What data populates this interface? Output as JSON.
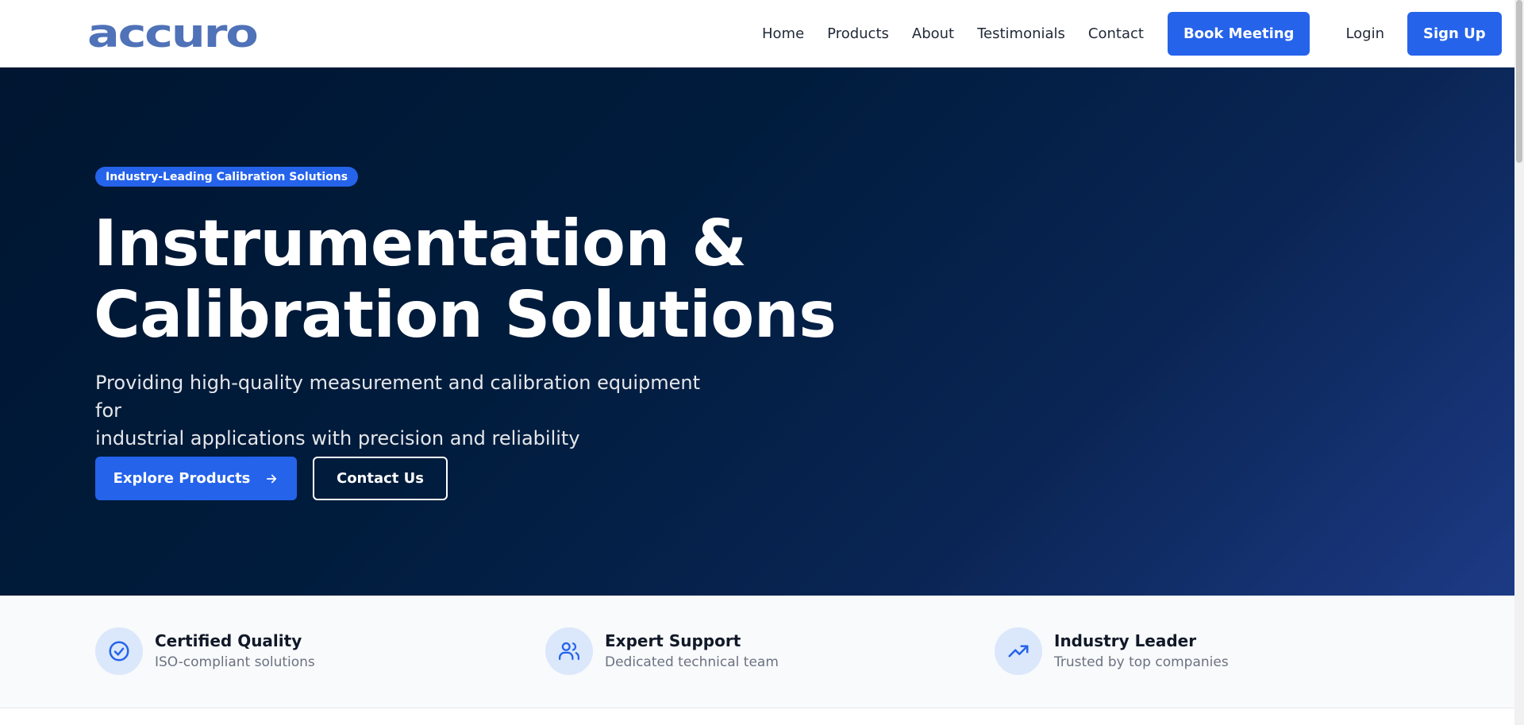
{
  "brand": {
    "logo_text": "accuro",
    "logo_color": "#4f72b8",
    "accent": "#2563eb"
  },
  "nav": {
    "links": [
      "Home",
      "Products",
      "About",
      "Testimonials",
      "Contact"
    ],
    "book_meeting": "Book Meeting",
    "login": "Login",
    "sign_up": "Sign Up"
  },
  "hero": {
    "badge": "Industry-Leading Calibration Solutions",
    "title_line1": "Instrumentation &",
    "title_line2": "Calibration Solutions",
    "subtitle_line1": "Providing high-quality measurement and calibration equipment for",
    "subtitle_line2": "industrial applications with precision and reliability",
    "primary_cta": "Explore Products",
    "primary_cta_icon": "arrow-right-icon",
    "secondary_cta": "Contact Us"
  },
  "features": [
    {
      "icon": "check-circle-icon",
      "title": "Certified Quality",
      "desc": "ISO-compliant solutions"
    },
    {
      "icon": "users-icon",
      "title": "Expert Support",
      "desc": "Dedicated technical team"
    },
    {
      "icon": "trending-up-icon",
      "title": "Industry Leader",
      "desc": "Trusted by top companies"
    }
  ]
}
